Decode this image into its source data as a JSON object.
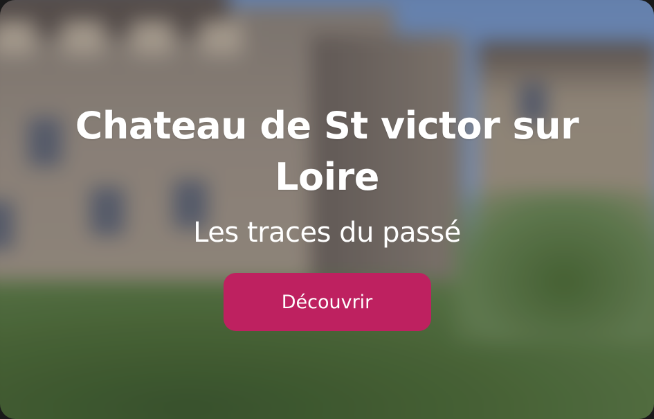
{
  "hero": {
    "title": "Chateau de St victor sur Loire",
    "subtitle": "Les traces du passé",
    "cta_label": "Découvrir",
    "background_image": "castle-photo",
    "accent_color": "#be2160"
  }
}
